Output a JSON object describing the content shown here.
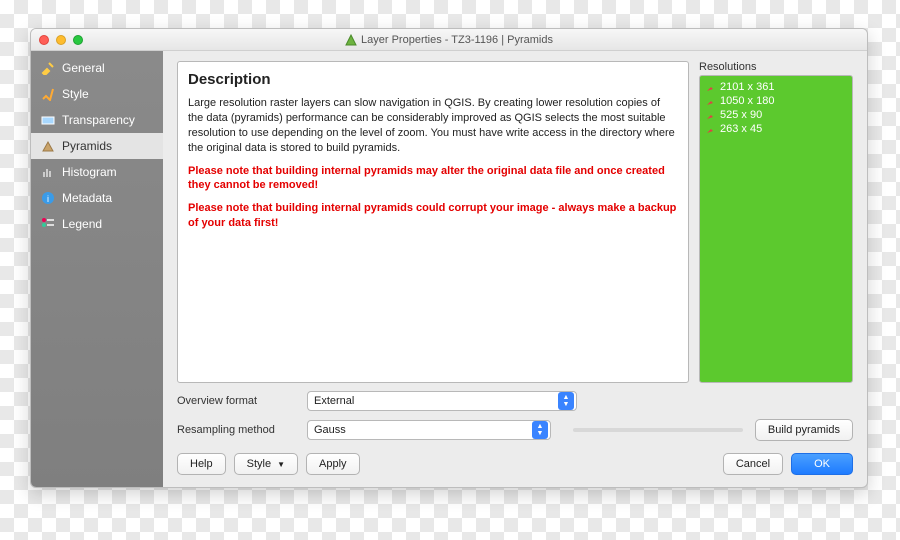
{
  "window": {
    "title": "Layer Properties - TZ3-1196 | Pyramids"
  },
  "sidebar": {
    "items": [
      {
        "label": "General",
        "icon": "tools-icon"
      },
      {
        "label": "Style",
        "icon": "brush-icon"
      },
      {
        "label": "Transparency",
        "icon": "transparency-icon"
      },
      {
        "label": "Pyramids",
        "icon": "pyramid-icon",
        "selected": true
      },
      {
        "label": "Histogram",
        "icon": "histogram-icon"
      },
      {
        "label": "Metadata",
        "icon": "info-icon"
      },
      {
        "label": "Legend",
        "icon": "legend-icon"
      }
    ]
  },
  "description": {
    "heading": "Description",
    "body": "Large resolution raster layers can slow navigation in QGIS. By creating lower resolution copies of the data (pyramids) performance can be considerably improved as QGIS selects the most suitable resolution to use depending on the level of zoom. You must have write access in the directory where the original data is stored to build pyramids.",
    "warning1": "Please note that building internal pyramids may alter the original data file and once created they cannot be removed!",
    "warning2": "Please note that building internal pyramids could corrupt your image - always make a backup of your data first!"
  },
  "resolutions": {
    "label": "Resolutions",
    "items": [
      "2101 x 361",
      "1050 x 180",
      "525 x 90",
      "263 x 45"
    ]
  },
  "form": {
    "overview_label": "Overview format",
    "overview_value": "External",
    "resampling_label": "Resampling method",
    "resampling_value": "Gauss",
    "build_label": "Build pyramids"
  },
  "buttons": {
    "help": "Help",
    "style": "Style",
    "apply": "Apply",
    "cancel": "Cancel",
    "ok": "OK"
  }
}
